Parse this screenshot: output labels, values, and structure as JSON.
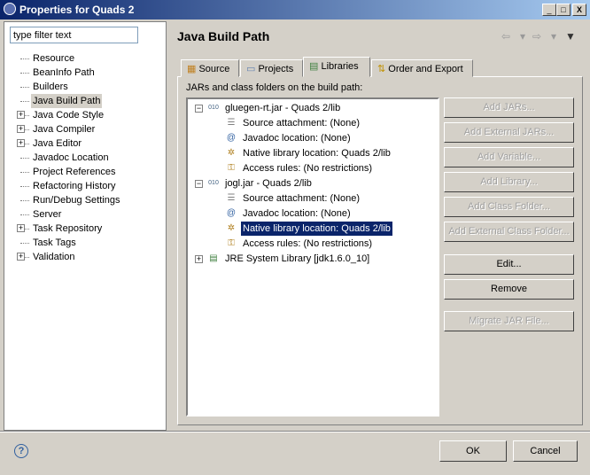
{
  "window": {
    "title": "Properties for Quads 2",
    "minimize": "_",
    "maximize": "□",
    "close": "X"
  },
  "filter": {
    "placeholder": "type filter text",
    "value": "type filter text"
  },
  "sidebar": {
    "items": [
      {
        "label": "Resource",
        "expandable": false
      },
      {
        "label": "BeanInfo Path",
        "expandable": false
      },
      {
        "label": "Builders",
        "expandable": false
      },
      {
        "label": "Java Build Path",
        "expandable": false,
        "selected": true
      },
      {
        "label": "Java Code Style",
        "expandable": true
      },
      {
        "label": "Java Compiler",
        "expandable": true
      },
      {
        "label": "Java Editor",
        "expandable": true
      },
      {
        "label": "Javadoc Location",
        "expandable": false
      },
      {
        "label": "Project References",
        "expandable": false
      },
      {
        "label": "Refactoring History",
        "expandable": false
      },
      {
        "label": "Run/Debug Settings",
        "expandable": false
      },
      {
        "label": "Server",
        "expandable": false
      },
      {
        "label": "Task Repository",
        "expandable": true
      },
      {
        "label": "Task Tags",
        "expandable": false
      },
      {
        "label": "Validation",
        "expandable": true
      }
    ]
  },
  "page": {
    "title": "Java Build Path",
    "nav": {
      "back": "⇦",
      "forward": "⇨",
      "menu": "▼",
      "dropdown": "▾"
    }
  },
  "tabs": [
    {
      "label": "Source"
    },
    {
      "label": "Projects"
    },
    {
      "label": "Libraries",
      "active": true
    },
    {
      "label": "Order and Export"
    }
  ],
  "libraries": {
    "label": "JARs and class folders on the build path:",
    "tree": [
      {
        "label": "gluegen-rt.jar - Quads 2/lib",
        "level": 0,
        "toggle": "−",
        "icon": "jar"
      },
      {
        "label": "Source attachment: (None)",
        "level": 1,
        "icon": "source"
      },
      {
        "label": "Javadoc location: (None)",
        "level": 1,
        "icon": "javadoc"
      },
      {
        "label": "Native library location: Quads 2/lib",
        "level": 1,
        "icon": "native"
      },
      {
        "label": "Access rules: (No restrictions)",
        "level": 1,
        "icon": "access"
      },
      {
        "label": "jogl.jar - Quads 2/lib",
        "level": 0,
        "toggle": "−",
        "icon": "jar"
      },
      {
        "label": "Source attachment: (None)",
        "level": 1,
        "icon": "source"
      },
      {
        "label": "Javadoc location: (None)",
        "level": 1,
        "icon": "javadoc"
      },
      {
        "label": "Native library location: Quads 2/lib",
        "level": 1,
        "icon": "native",
        "selected": true
      },
      {
        "label": "Access rules: (No restrictions)",
        "level": 1,
        "icon": "access"
      },
      {
        "label": "JRE System Library [jdk1.6.0_10]",
        "level": 0,
        "toggle": "+",
        "icon": "library"
      }
    ]
  },
  "buttons": [
    {
      "label": "Add JARs...",
      "enabled": false
    },
    {
      "label": "Add External JARs...",
      "enabled": false
    },
    {
      "label": "Add Variable...",
      "enabled": false
    },
    {
      "label": "Add Library...",
      "enabled": false
    },
    {
      "label": "Add Class Folder...",
      "enabled": false
    },
    {
      "label": "Add External Class Folder...",
      "enabled": false
    },
    {
      "label": "Edit...",
      "enabled": true
    },
    {
      "label": "Remove",
      "enabled": true
    },
    {
      "label": "Migrate JAR File...",
      "enabled": false
    }
  ],
  "footer": {
    "help": "?",
    "ok": "OK",
    "cancel": "Cancel"
  }
}
